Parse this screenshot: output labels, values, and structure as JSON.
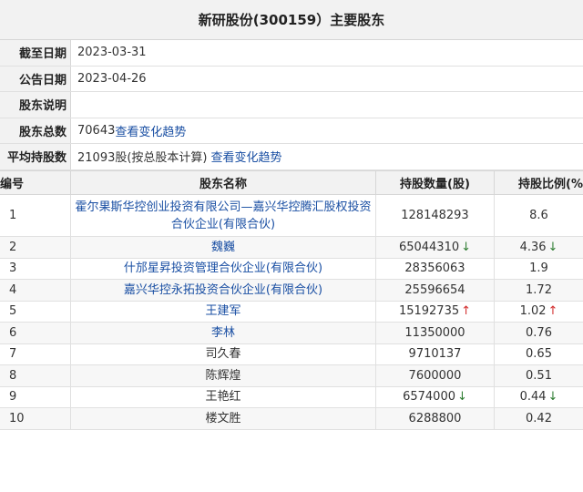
{
  "title": "新研股份(300159）主要股东",
  "info": [
    {
      "label": "截至日期",
      "value": "2023-03-31"
    },
    {
      "label": "公告日期",
      "value": "2023-04-26"
    },
    {
      "label": "股东说明",
      "value": ""
    },
    {
      "label": "股东总数",
      "value": "70643",
      "link": "查看变化趋势"
    },
    {
      "label": "平均持股数",
      "value": "21093股(按总股本计算)",
      "link": "查看变化趋势"
    }
  ],
  "table": {
    "headers": [
      "编号",
      "股东名称",
      "持股数量(股)",
      "持股比例(%)"
    ],
    "rows": [
      {
        "idx": "1",
        "name": "霍尔果斯华控创业投资有限公司—嘉兴华控腾汇股权投资合伙企业(有限合伙)",
        "linked": true,
        "qty": "128148293",
        "qty_trend": "",
        "pct": "8.6",
        "pct_trend": ""
      },
      {
        "idx": "2",
        "name": "魏巍",
        "linked": true,
        "qty": "65044310",
        "qty_trend": "↓",
        "pct": "4.36",
        "pct_trend": "↓"
      },
      {
        "idx": "3",
        "name": "什邡星昇投资管理合伙企业(有限合伙)",
        "linked": true,
        "qty": "28356063",
        "qty_trend": "",
        "pct": "1.9",
        "pct_trend": ""
      },
      {
        "idx": "4",
        "name": "嘉兴华控永拓投资合伙企业(有限合伙)",
        "linked": true,
        "qty": "25596654",
        "qty_trend": "",
        "pct": "1.72",
        "pct_trend": ""
      },
      {
        "idx": "5",
        "name": "王建军",
        "linked": true,
        "qty": "15192735",
        "qty_trend": "↑",
        "pct": "1.02",
        "pct_trend": "↑"
      },
      {
        "idx": "6",
        "name": "李林",
        "linked": true,
        "qty": "11350000",
        "qty_trend": "",
        "pct": "0.76",
        "pct_trend": ""
      },
      {
        "idx": "7",
        "name": "司久春",
        "linked": false,
        "qty": "9710137",
        "qty_trend": "",
        "pct": "0.65",
        "pct_trend": ""
      },
      {
        "idx": "8",
        "name": "陈辉煌",
        "linked": false,
        "qty": "7600000",
        "qty_trend": "",
        "pct": "0.51",
        "pct_trend": ""
      },
      {
        "idx": "9",
        "name": "王艳红",
        "linked": false,
        "qty": "6574000",
        "qty_trend": "↓",
        "pct": "0.44",
        "pct_trend": "↓"
      },
      {
        "idx": "10",
        "name": "楼文胜",
        "linked": false,
        "qty": "6288800",
        "qty_trend": "",
        "pct": "0.42",
        "pct_trend": ""
      }
    ]
  },
  "colors": {
    "link": "#1a4fa3",
    "up": "#d32f2f",
    "down": "#2e7d32",
    "header_bg": "#f2f2f2"
  }
}
